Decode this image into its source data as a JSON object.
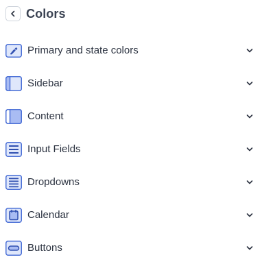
{
  "header": {
    "title": "Colors",
    "back_icon": "chevron-left-icon"
  },
  "colors": {
    "icon_stroke": "#4a6fd6",
    "icon_fill_light": "#dfe7fb",
    "icon_fill_mid": "#a9bcf3",
    "chevron": "#2b3240"
  },
  "sections": [
    {
      "label": "Primary and state colors",
      "icon": "paintbrush-icon"
    },
    {
      "label": "Sidebar",
      "icon": "sidebar-layout-icon"
    },
    {
      "label": "Content",
      "icon": "content-layout-icon"
    },
    {
      "label": "Input Fields",
      "icon": "input-fields-icon"
    },
    {
      "label": "Dropdowns",
      "icon": "dropdown-list-icon"
    },
    {
      "label": "Calendar",
      "icon": "calendar-icon"
    },
    {
      "label": "Buttons",
      "icon": "button-icon"
    }
  ]
}
